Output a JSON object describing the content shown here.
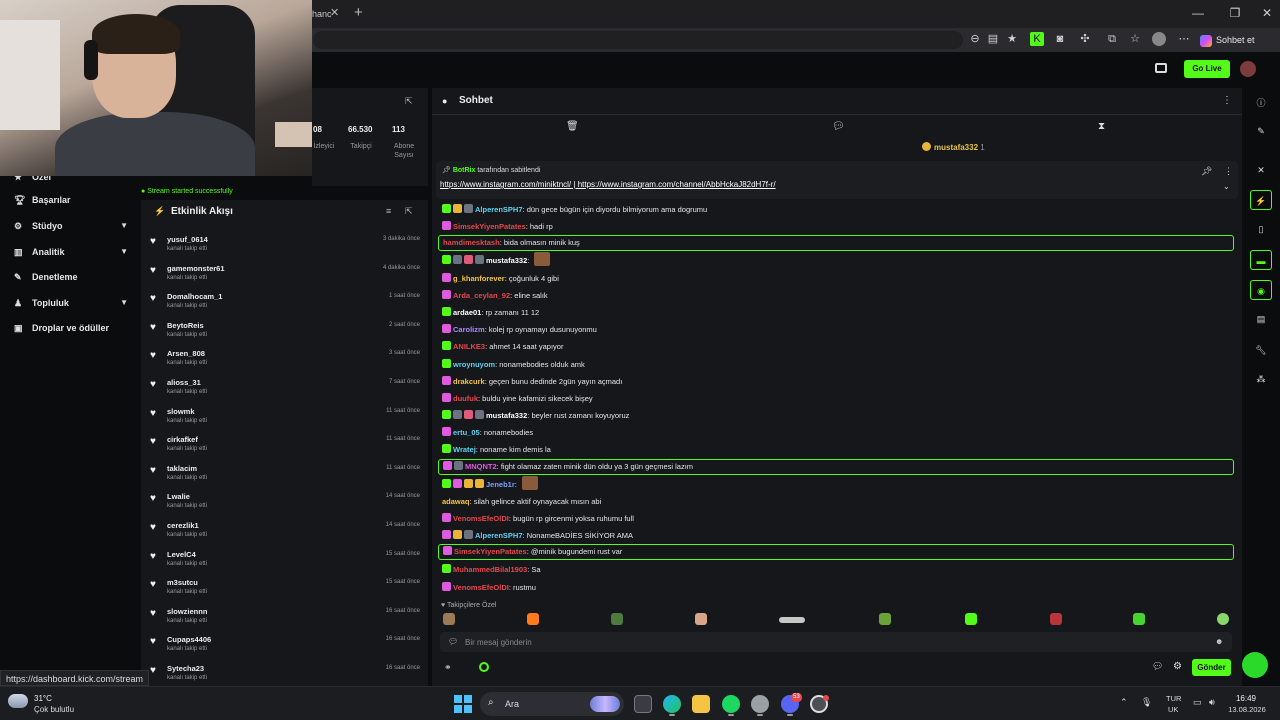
{
  "browser": {
    "tab_title": "hanc",
    "url_hint": "",
    "sohbet_label": "Sohbet et"
  },
  "kick_header": {
    "go_live": "Go Live"
  },
  "sidebar": {
    "items": [
      {
        "label": "Özel",
        "icon": "star-icon",
        "has_chevron": false
      },
      {
        "label": "Başarılar",
        "icon": "trophy-icon",
        "has_chevron": false
      },
      {
        "label": "Stüdyo",
        "icon": "gear-icon",
        "has_chevron": true
      },
      {
        "label": "Analitik",
        "icon": "chart-icon",
        "has_chevron": true
      },
      {
        "label": "Denetleme",
        "icon": "wrench-icon",
        "has_chevron": false
      },
      {
        "label": "Topluluk",
        "icon": "users-icon",
        "has_chevron": true
      },
      {
        "label": "Droplar ve ödüller",
        "icon": "gift-icon",
        "has_chevron": false
      }
    ]
  },
  "stats": {
    "items": [
      {
        "value": "08",
        "label": "İzleyici"
      },
      {
        "value": "66.530",
        "label": "Takipçi"
      },
      {
        "value": "113",
        "label": "Abone Sayısı"
      }
    ],
    "toast": "Stream started successfully"
  },
  "feed": {
    "title": "Etkinlik Akışı",
    "subtitle": "kanalı takip etti",
    "rows": [
      {
        "name": "yusuf_0614",
        "time": "3 dakika önce"
      },
      {
        "name": "gamemonster61",
        "time": "4 dakika önce"
      },
      {
        "name": "Domalhocam_1",
        "time": "1 saat önce"
      },
      {
        "name": "BeytoReis",
        "time": "2 saat önce"
      },
      {
        "name": "Arsen_808",
        "time": "3 saat önce"
      },
      {
        "name": "alioss_31",
        "time": "7 saat önce"
      },
      {
        "name": "slowmk",
        "time": "11 saat önce"
      },
      {
        "name": "cirkafkef",
        "time": "11 saat önce"
      },
      {
        "name": "taklacim",
        "time": "11 saat önce"
      },
      {
        "name": "Lwalie",
        "time": "14 saat önce"
      },
      {
        "name": "cerezlik1",
        "time": "14 saat önce"
      },
      {
        "name": "LevelC4",
        "time": "15 saat önce"
      },
      {
        "name": "m3sutcu",
        "time": "15 saat önce"
      },
      {
        "name": "slowziennn",
        "time": "16 saat önce"
      },
      {
        "name": "Cupaps4406",
        "time": "16 saat önce"
      },
      {
        "name": "Sytecha23",
        "time": "16 saat önce"
      }
    ]
  },
  "status_url": "https://dashboard.kick.com/stream",
  "chat": {
    "title": "Sohbet",
    "gifter": {
      "name": "mustafa332",
      "count": "1"
    },
    "pinned": {
      "by_user": "BotRix",
      "by_suffix": " tarafından sabitlendi",
      "link1": "https://www.instagram.com/miniktncl/",
      "separator": " | ",
      "link2": "https://www.instagram.com/channel/AbbHckaJ82dH7f-r/"
    },
    "messages": [
      {
        "user": "AlperenSPH7",
        "color": "#5fd3f3",
        "text": "dün gece bügün için diyordu bilmiyorum ama dogrumu",
        "badges": [
          "#53fc18",
          "#e8b43a",
          "#6b7280"
        ],
        "hl": false,
        "emote": false
      },
      {
        "user": "SimsekYiyenPatates",
        "color": "#e5484d",
        "text": "hadi rp",
        "badges": [
          "#e05adf"
        ],
        "hl": false,
        "emote": false
      },
      {
        "user": "hamdimesktash",
        "color": "#e5484d",
        "text": "bida olmasın minik kuş",
        "badges": [],
        "hl": true,
        "emote": false
      },
      {
        "user": "mustafa332",
        "color": "#ffffff",
        "text": "",
        "badges": [
          "#53fc18",
          "#6b7280",
          "#e05a7a",
          "#6b7280"
        ],
        "hl": false,
        "emote": true
      },
      {
        "user": "g_khanforever",
        "color": "#f4c542",
        "text": "çoğunluk 4 gibi",
        "badges": [
          "#e05adf"
        ],
        "hl": false,
        "emote": false
      },
      {
        "user": "Arda_ceylan_92",
        "color": "#e5484d",
        "text": "eline salık",
        "badges": [
          "#e05adf"
        ],
        "hl": false,
        "emote": false
      },
      {
        "user": "ardae01",
        "color": "#ffffff",
        "text": "rp zamanı 11 12",
        "badges": [
          "#53fc18"
        ],
        "hl": false,
        "emote": false
      },
      {
        "user": "Carolizm",
        "color": "#a78bfa",
        "text": "kolej rp oynamayı dusunuyonmu",
        "badges": [
          "#e05adf"
        ],
        "hl": false,
        "emote": false
      },
      {
        "user": "ANILKE3",
        "color": "#e5484d",
        "text": "ahmet 14 saat yapıyor",
        "badges": [
          "#53fc18"
        ],
        "hl": false,
        "emote": false
      },
      {
        "user": "wroynuyom",
        "color": "#5fd3f3",
        "text": "nonamebodies olduk amk",
        "badges": [
          "#53fc18"
        ],
        "hl": false,
        "emote": false
      },
      {
        "user": "drakcurk",
        "color": "#f4c542",
        "text": "geçen bunu dedinde 2gün yayın açmadı",
        "badges": [
          "#e05adf"
        ],
        "hl": false,
        "emote": false
      },
      {
        "user": "duufuk",
        "color": "#e5484d",
        "text": "buldu yine kafamizi sikecek bişey",
        "badges": [
          "#e05adf"
        ],
        "hl": false,
        "emote": false
      },
      {
        "user": "mustafa332",
        "color": "#ffffff",
        "text": "beyler rust zamanı koyuyoruz",
        "badges": [
          "#53fc18",
          "#6b7280",
          "#e05a7a",
          "#6b7280"
        ],
        "hl": false,
        "emote": false
      },
      {
        "user": "ertu_05",
        "color": "#5fd3f3",
        "text": "nonamebodies",
        "badges": [
          "#e05adf"
        ],
        "hl": false,
        "emote": false
      },
      {
        "user": "Wratej",
        "color": "#5fd3f3",
        "text": "noname kim demis la",
        "badges": [
          "#53fc18"
        ],
        "hl": false,
        "emote": false
      },
      {
        "user": "MNQNT2",
        "color": "#e05adf",
        "text": "fight olamaz zaten minik dün oldu ya 3 gün geçmesi lazım",
        "badges": [
          "#e05adf",
          "#6b7280"
        ],
        "hl": true,
        "emote": false
      },
      {
        "user": "Jeneb1r",
        "color": "#7aa2ff",
        "text": "",
        "badges": [
          "#53fc18",
          "#e05adf",
          "#e8b43a",
          "#e8b43a"
        ],
        "hl": false,
        "emote": true
      },
      {
        "user": "adawaq",
        "color": "#f4c542",
        "text": "silah gelince aktif oynayacak mısın abi",
        "badges": [],
        "hl": false,
        "emote": false
      },
      {
        "user": "VenomsEfeOlDI",
        "color": "#e5484d",
        "text": "bugün rp gircenmi yoksa ruhumu full",
        "badges": [
          "#e05adf"
        ],
        "hl": false,
        "emote": false
      },
      {
        "user": "AlperenSPH7",
        "color": "#5fd3f3",
        "text": "NonameBADİES SİKİYOR AMA",
        "badges": [
          "#e05adf",
          "#e8b43a",
          "#6b7280"
        ],
        "hl": false,
        "emote": false
      },
      {
        "user": "SimsekYiyenPatates",
        "color": "#e5484d",
        "text": "@minik bugundemi rust var",
        "badges": [
          "#e05adf"
        ],
        "hl": true,
        "emote": false
      },
      {
        "user": "MuhammedBilal1903",
        "color": "#e5484d",
        "text": "Sa",
        "badges": [
          "#53fc18"
        ],
        "hl": false,
        "emote": false
      },
      {
        "user": "VenomsEfeOlDI",
        "color": "#e5484d",
        "text": "rustmu",
        "badges": [
          "#e05adf"
        ],
        "hl": false,
        "emote": false
      }
    ],
    "followers_only": "Takipçilere Özel",
    "input_placeholder": "Bir mesaj gönderin",
    "send_label": "Gönder"
  },
  "taskbar": {
    "temp": "31°C",
    "weather": "Çok bulutlu",
    "search_label": "Ara",
    "lang1": "TUR",
    "lang2": "UK",
    "time": "16:49",
    "date": "13.08.2026",
    "discord_badge": "53"
  }
}
